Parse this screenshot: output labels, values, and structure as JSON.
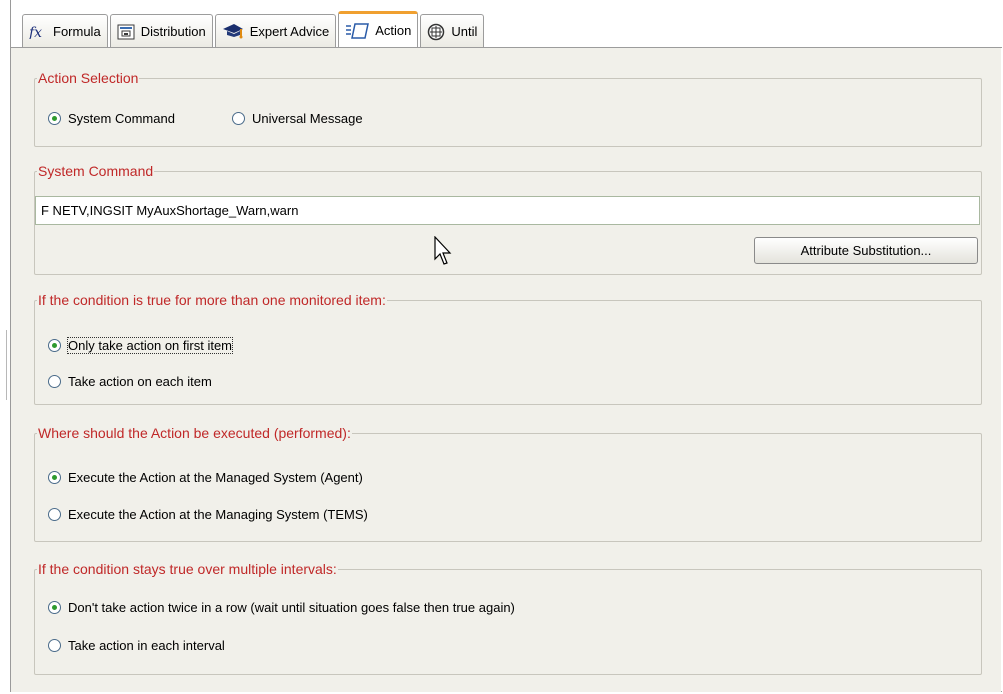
{
  "tabs": [
    {
      "label": "Formula",
      "icon": "fx-icon",
      "active": false
    },
    {
      "label": "Distribution",
      "icon": "distribution-icon",
      "active": false
    },
    {
      "label": "Expert Advice",
      "icon": "graduation-cap-icon",
      "active": false
    },
    {
      "label": "Action",
      "icon": "action-icon",
      "active": true
    },
    {
      "label": "Until",
      "icon": "until-icon",
      "active": false
    }
  ],
  "action_selection": {
    "legend": "Action Selection",
    "options": [
      {
        "label": "System Command",
        "selected": true
      },
      {
        "label": "Universal Message",
        "selected": false
      }
    ]
  },
  "system_command": {
    "legend": "System Command",
    "value": "F NETV,INGSIT MyAuxShortage_Warn,warn",
    "button_label": "Attribute Substitution..."
  },
  "multiple_items": {
    "legend": "If the condition is true for more than one monitored item:",
    "options": [
      {
        "label": "Only take action on first item",
        "selected": true
      },
      {
        "label": "Take action on each item",
        "selected": false
      }
    ]
  },
  "execution_location": {
    "legend": "Where should the Action be executed (performed):",
    "options": [
      {
        "label": "Execute the Action at the Managed System (Agent)",
        "selected": true
      },
      {
        "label": "Execute the Action at the Managing System (TEMS)",
        "selected": false
      }
    ]
  },
  "intervals": {
    "legend": "If the condition stays true over multiple intervals:",
    "options": [
      {
        "label": "Don't take action twice in a row (wait until situation goes false then true again)",
        "selected": true
      },
      {
        "label": "Take action in each interval",
        "selected": false
      }
    ]
  },
  "colors": {
    "legend_text": "#c02828",
    "panel_bg": "#f1f0ea",
    "active_tab_accent": "#f0a030",
    "radio_dot": "#2e9a2e"
  }
}
